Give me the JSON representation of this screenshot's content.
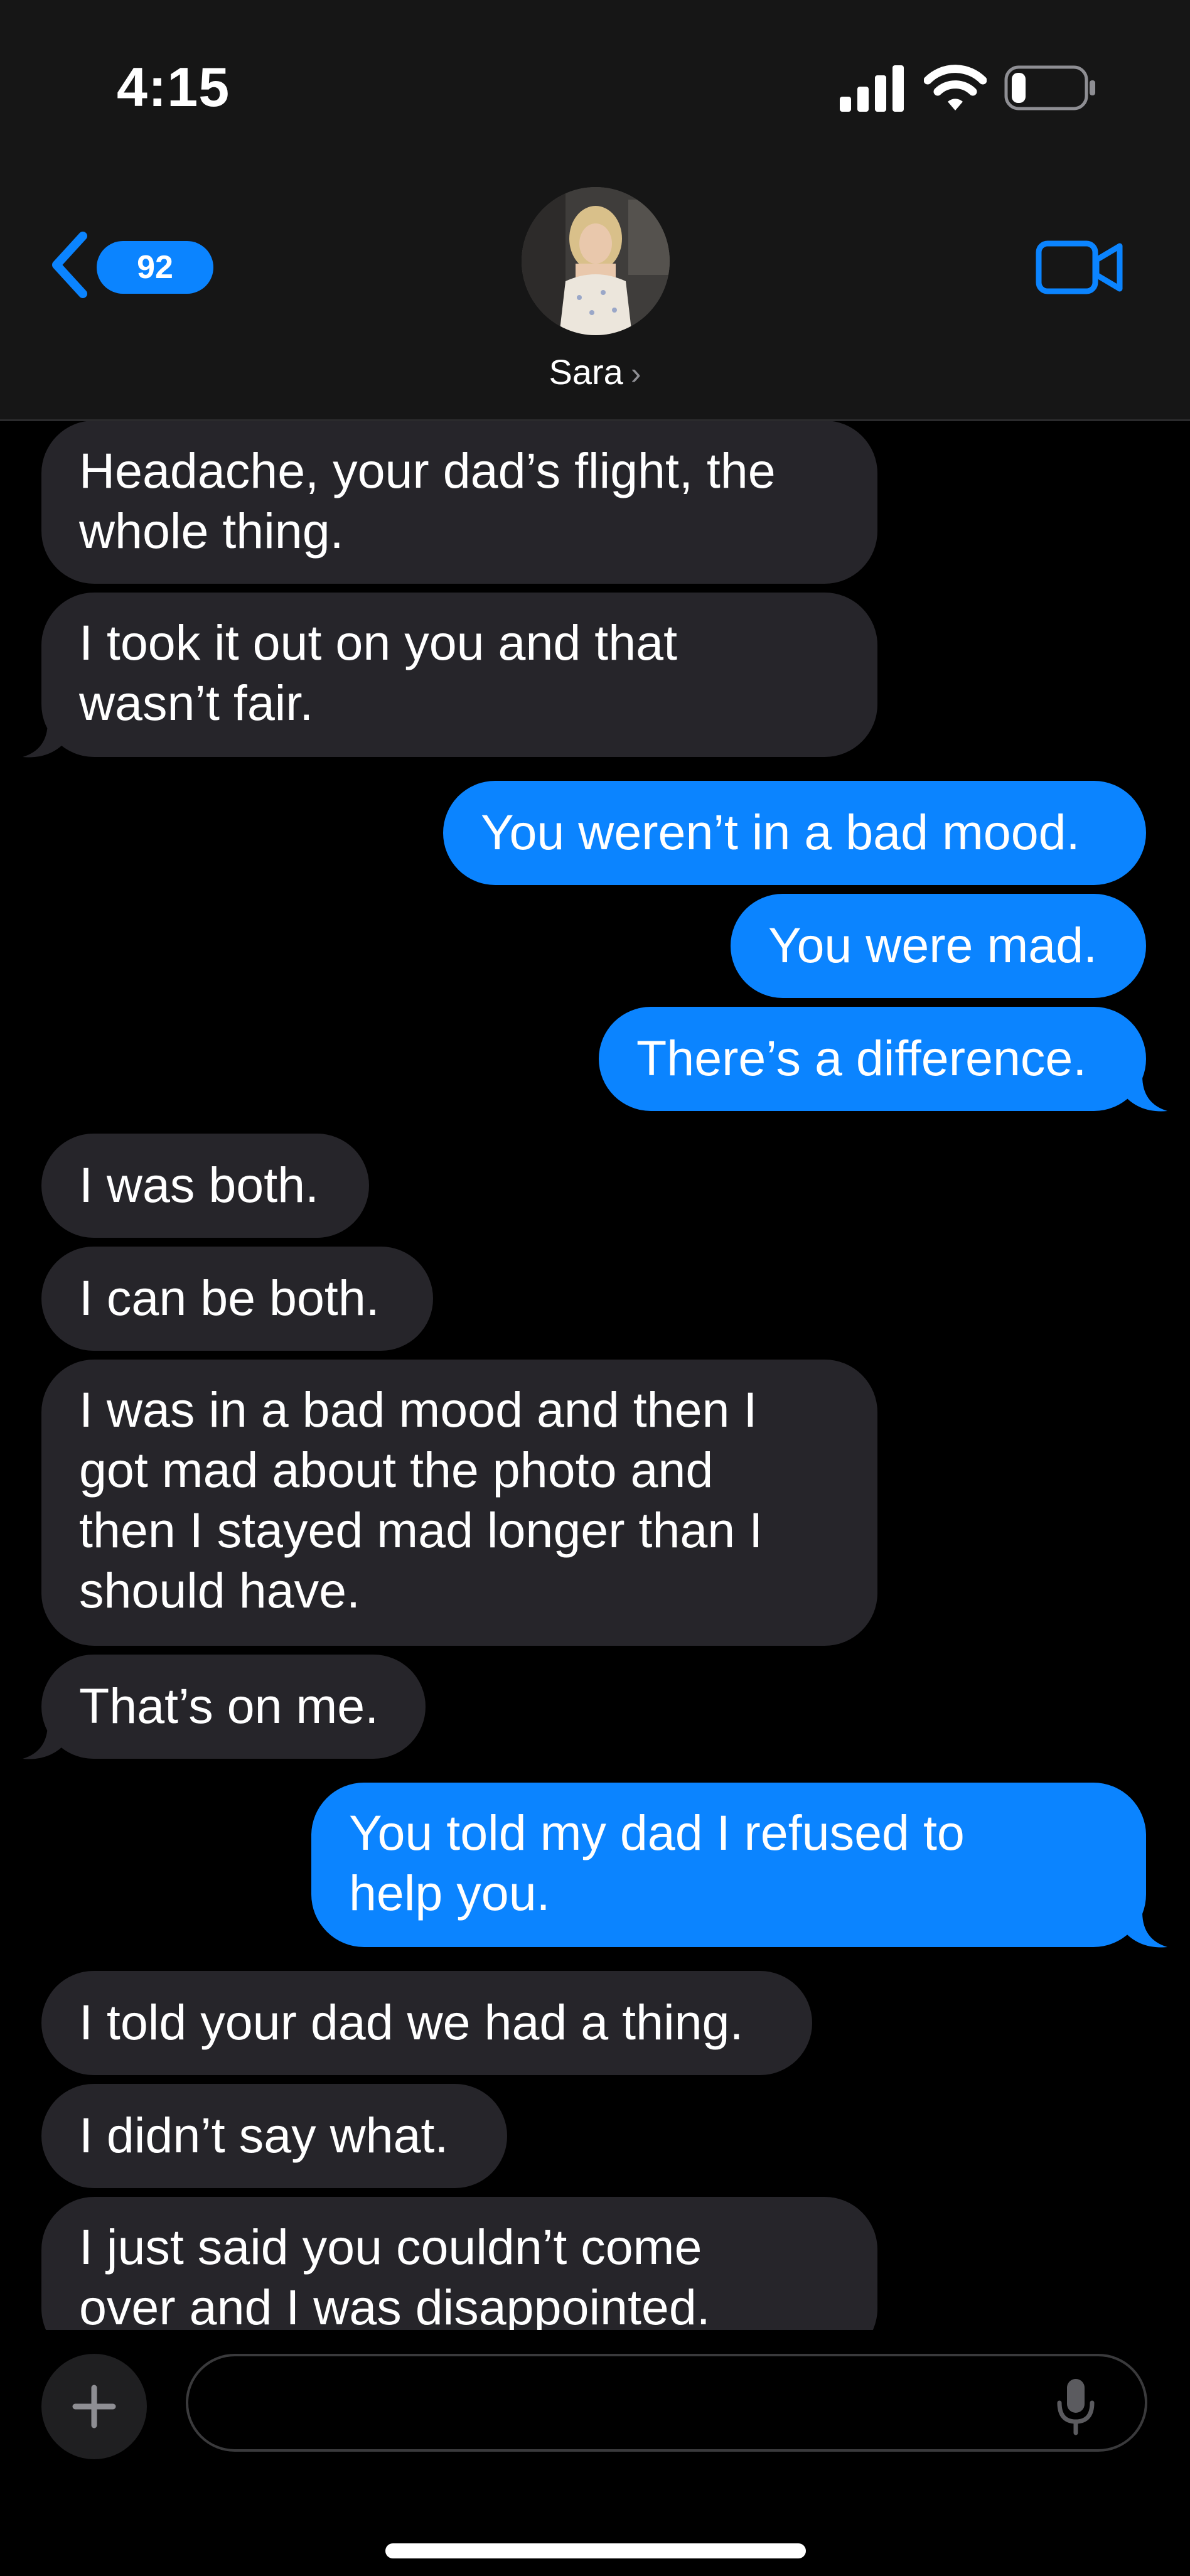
{
  "status_bar": {
    "time": "4:15",
    "signal_icon": "cellular-signal-icon",
    "wifi_icon": "wifi-icon",
    "battery_icon": "battery-icon",
    "battery_level": 0.2
  },
  "header": {
    "back_icon": "chevron-left-icon",
    "unread_count": "92",
    "contact_name": "Sara",
    "name_chevron": "›",
    "video_icon": "video-camera-icon",
    "accent_color": "#0b84ff"
  },
  "messages": [
    {
      "direction": "in",
      "text": "Headache, your dad’s flight, the\nwhole thing."
    },
    {
      "direction": "in",
      "text": "I took it out on you and that\nwasn’t fair."
    },
    {
      "direction": "out",
      "text": "You weren’t in a bad mood."
    },
    {
      "direction": "out",
      "text": "You were mad."
    },
    {
      "direction": "out",
      "text": "There’s a difference."
    },
    {
      "direction": "in",
      "text": "I was both."
    },
    {
      "direction": "in",
      "text": "I can be both."
    },
    {
      "direction": "in",
      "text": "I was in a bad mood and then I\ngot mad about the photo and\nthen I stayed mad longer than I\nshould have."
    },
    {
      "direction": "in",
      "text": "That’s on me."
    },
    {
      "direction": "out",
      "text": "You told my dad I refused to\nhelp you."
    },
    {
      "direction": "in",
      "text": "I told your dad we had a thing."
    },
    {
      "direction": "in",
      "text": "I didn’t say what."
    },
    {
      "direction": "in",
      "text": "I just said you couldn’t come\nover and I was disappointed."
    }
  ],
  "composer": {
    "plus_icon": "plus-icon",
    "placeholder": "",
    "mic_icon": "microphone-icon"
  }
}
